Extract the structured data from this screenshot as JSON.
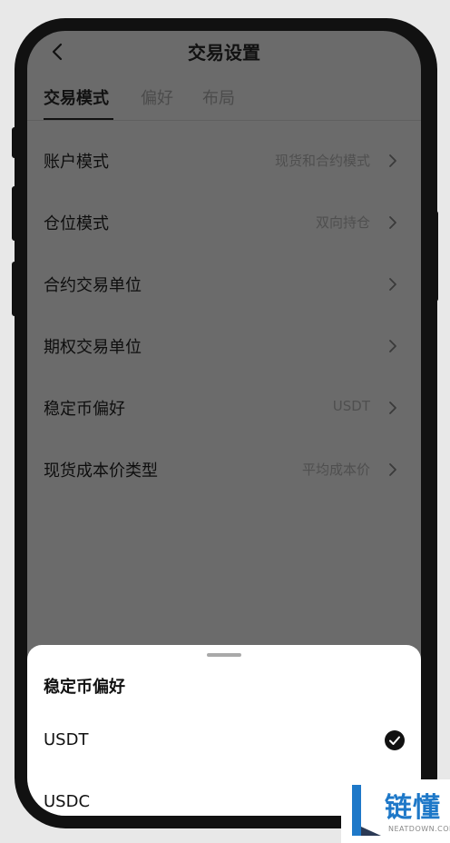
{
  "header": {
    "title": "交易设置"
  },
  "tabs": [
    {
      "label": "交易模式"
    },
    {
      "label": "偏好"
    },
    {
      "label": "布局"
    }
  ],
  "settings": [
    {
      "label": "账户模式",
      "value": "现货和合约模式"
    },
    {
      "label": "仓位模式",
      "value": "双向持仓"
    },
    {
      "label": "合约交易单位",
      "value": ""
    },
    {
      "label": "期权交易单位",
      "value": ""
    },
    {
      "label": "稳定币偏好",
      "value": "USDT"
    },
    {
      "label": "现货成本价类型",
      "value": "平均成本价"
    }
  ],
  "sheet": {
    "title": "稳定币偏好",
    "options": [
      {
        "label": "USDT",
        "selected": true
      },
      {
        "label": "USDC",
        "selected": false
      }
    ]
  },
  "watermark": {
    "text": "链懂",
    "sub": "NEATDOWN.COM"
  },
  "colors": {
    "accent_logo": "#1e78c8",
    "overlay": "#6b6b6b"
  },
  "icons": [
    "back-icon",
    "chevron-right-icon",
    "check-circle-icon",
    "logo-icon"
  ]
}
